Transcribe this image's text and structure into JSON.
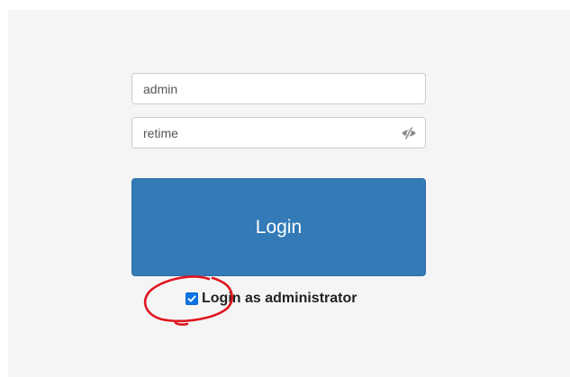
{
  "login_form": {
    "username_value": "admin",
    "password_value": "retime",
    "password_toggle_icon": "eye-slash-icon",
    "login_label": "Login",
    "admin_checkbox_checked": true,
    "admin_label": "Login as administrator"
  },
  "colors": {
    "panel_background": "#f5f5f5",
    "button_primary": "#337ab7",
    "checkbox_checked": "#0b74e5",
    "annotation": "#e0141e"
  }
}
